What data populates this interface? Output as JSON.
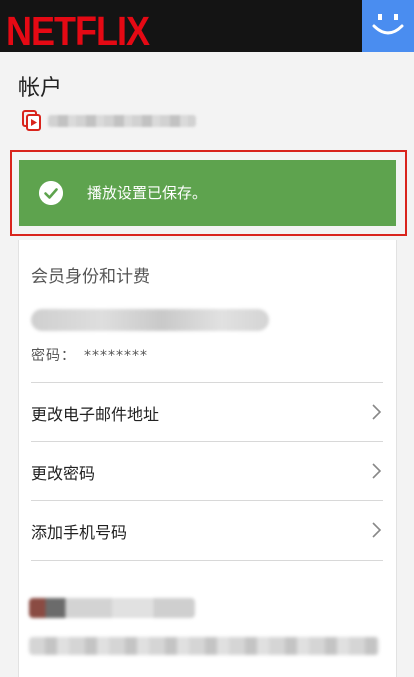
{
  "header": {
    "logo_text": "NETFLIX",
    "brand_color": "#e50914",
    "profile_icon": "smiley-profile-icon",
    "profile_color": "#4a8df0"
  },
  "account": {
    "title": "帐户",
    "member_icon": "member-since-icon"
  },
  "alert": {
    "text": "播放设置已保存。",
    "icon": "check-circle-icon",
    "color": "#5ea34e",
    "highlight_color": "#d9241c"
  },
  "membership": {
    "heading": "会员身份和计费",
    "password_label": "密码：",
    "password_value": "********",
    "rows": [
      {
        "label": "更改电子邮件地址",
        "icon": "chevron-right-icon"
      },
      {
        "label": "更改密码",
        "icon": "chevron-right-icon"
      },
      {
        "label": "添加手机号码",
        "icon": "chevron-right-icon"
      }
    ]
  }
}
